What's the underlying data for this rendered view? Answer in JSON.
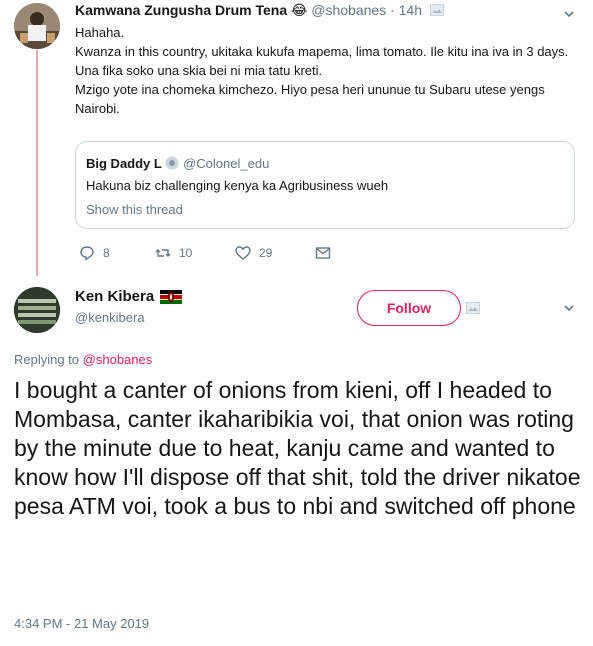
{
  "tweet1": {
    "display_name": "Kamwana Zungusha Drum Tena",
    "emoji": "😂",
    "handle": "@shobanes",
    "separator": " · ",
    "time": "14h",
    "lines": [
      "Hahaha.",
      "Kwanza in this country, ukitaka kukufa mapema, lima tomato. Ile kitu ina iva in 3 days. Una fika soko una skia bei ni mia tatu kreti.",
      "Mzigo yote ina chomeka kimchezo. Hiyo pesa heri ununue tu Subaru utese yengs Nairobi."
    ],
    "quote": {
      "display_name": "Big Daddy L",
      "handle": "@Colonel_edu",
      "text": "Hakuna biz challenging kenya ka Agribusiness wueh",
      "link_label": "Show this thread"
    },
    "actions": {
      "replies": "8",
      "retweets": "10",
      "likes": "29"
    }
  },
  "tweet2": {
    "display_name": "Ken Kibera",
    "handle": "@kenkibera",
    "follow_label": "Follow",
    "replying_prefix": "Replying to ",
    "replying_to": "@shobanes",
    "text": "I bought a canter of onions from kieni, off I headed to Mombasa, canter ikaharibikia voi, that onion was roting by the minute due to heat, kanju came and wanted to know how I'll dispose off that shit, told the driver nikatoe pesa ATM voi, took a bus to nbi and switched off phone",
    "timestamp": "4:34 PM - 21 May 2019"
  },
  "colors": {
    "accent": "#e0245e",
    "muted": "#657786",
    "thread_line": "#e6a7b0"
  }
}
